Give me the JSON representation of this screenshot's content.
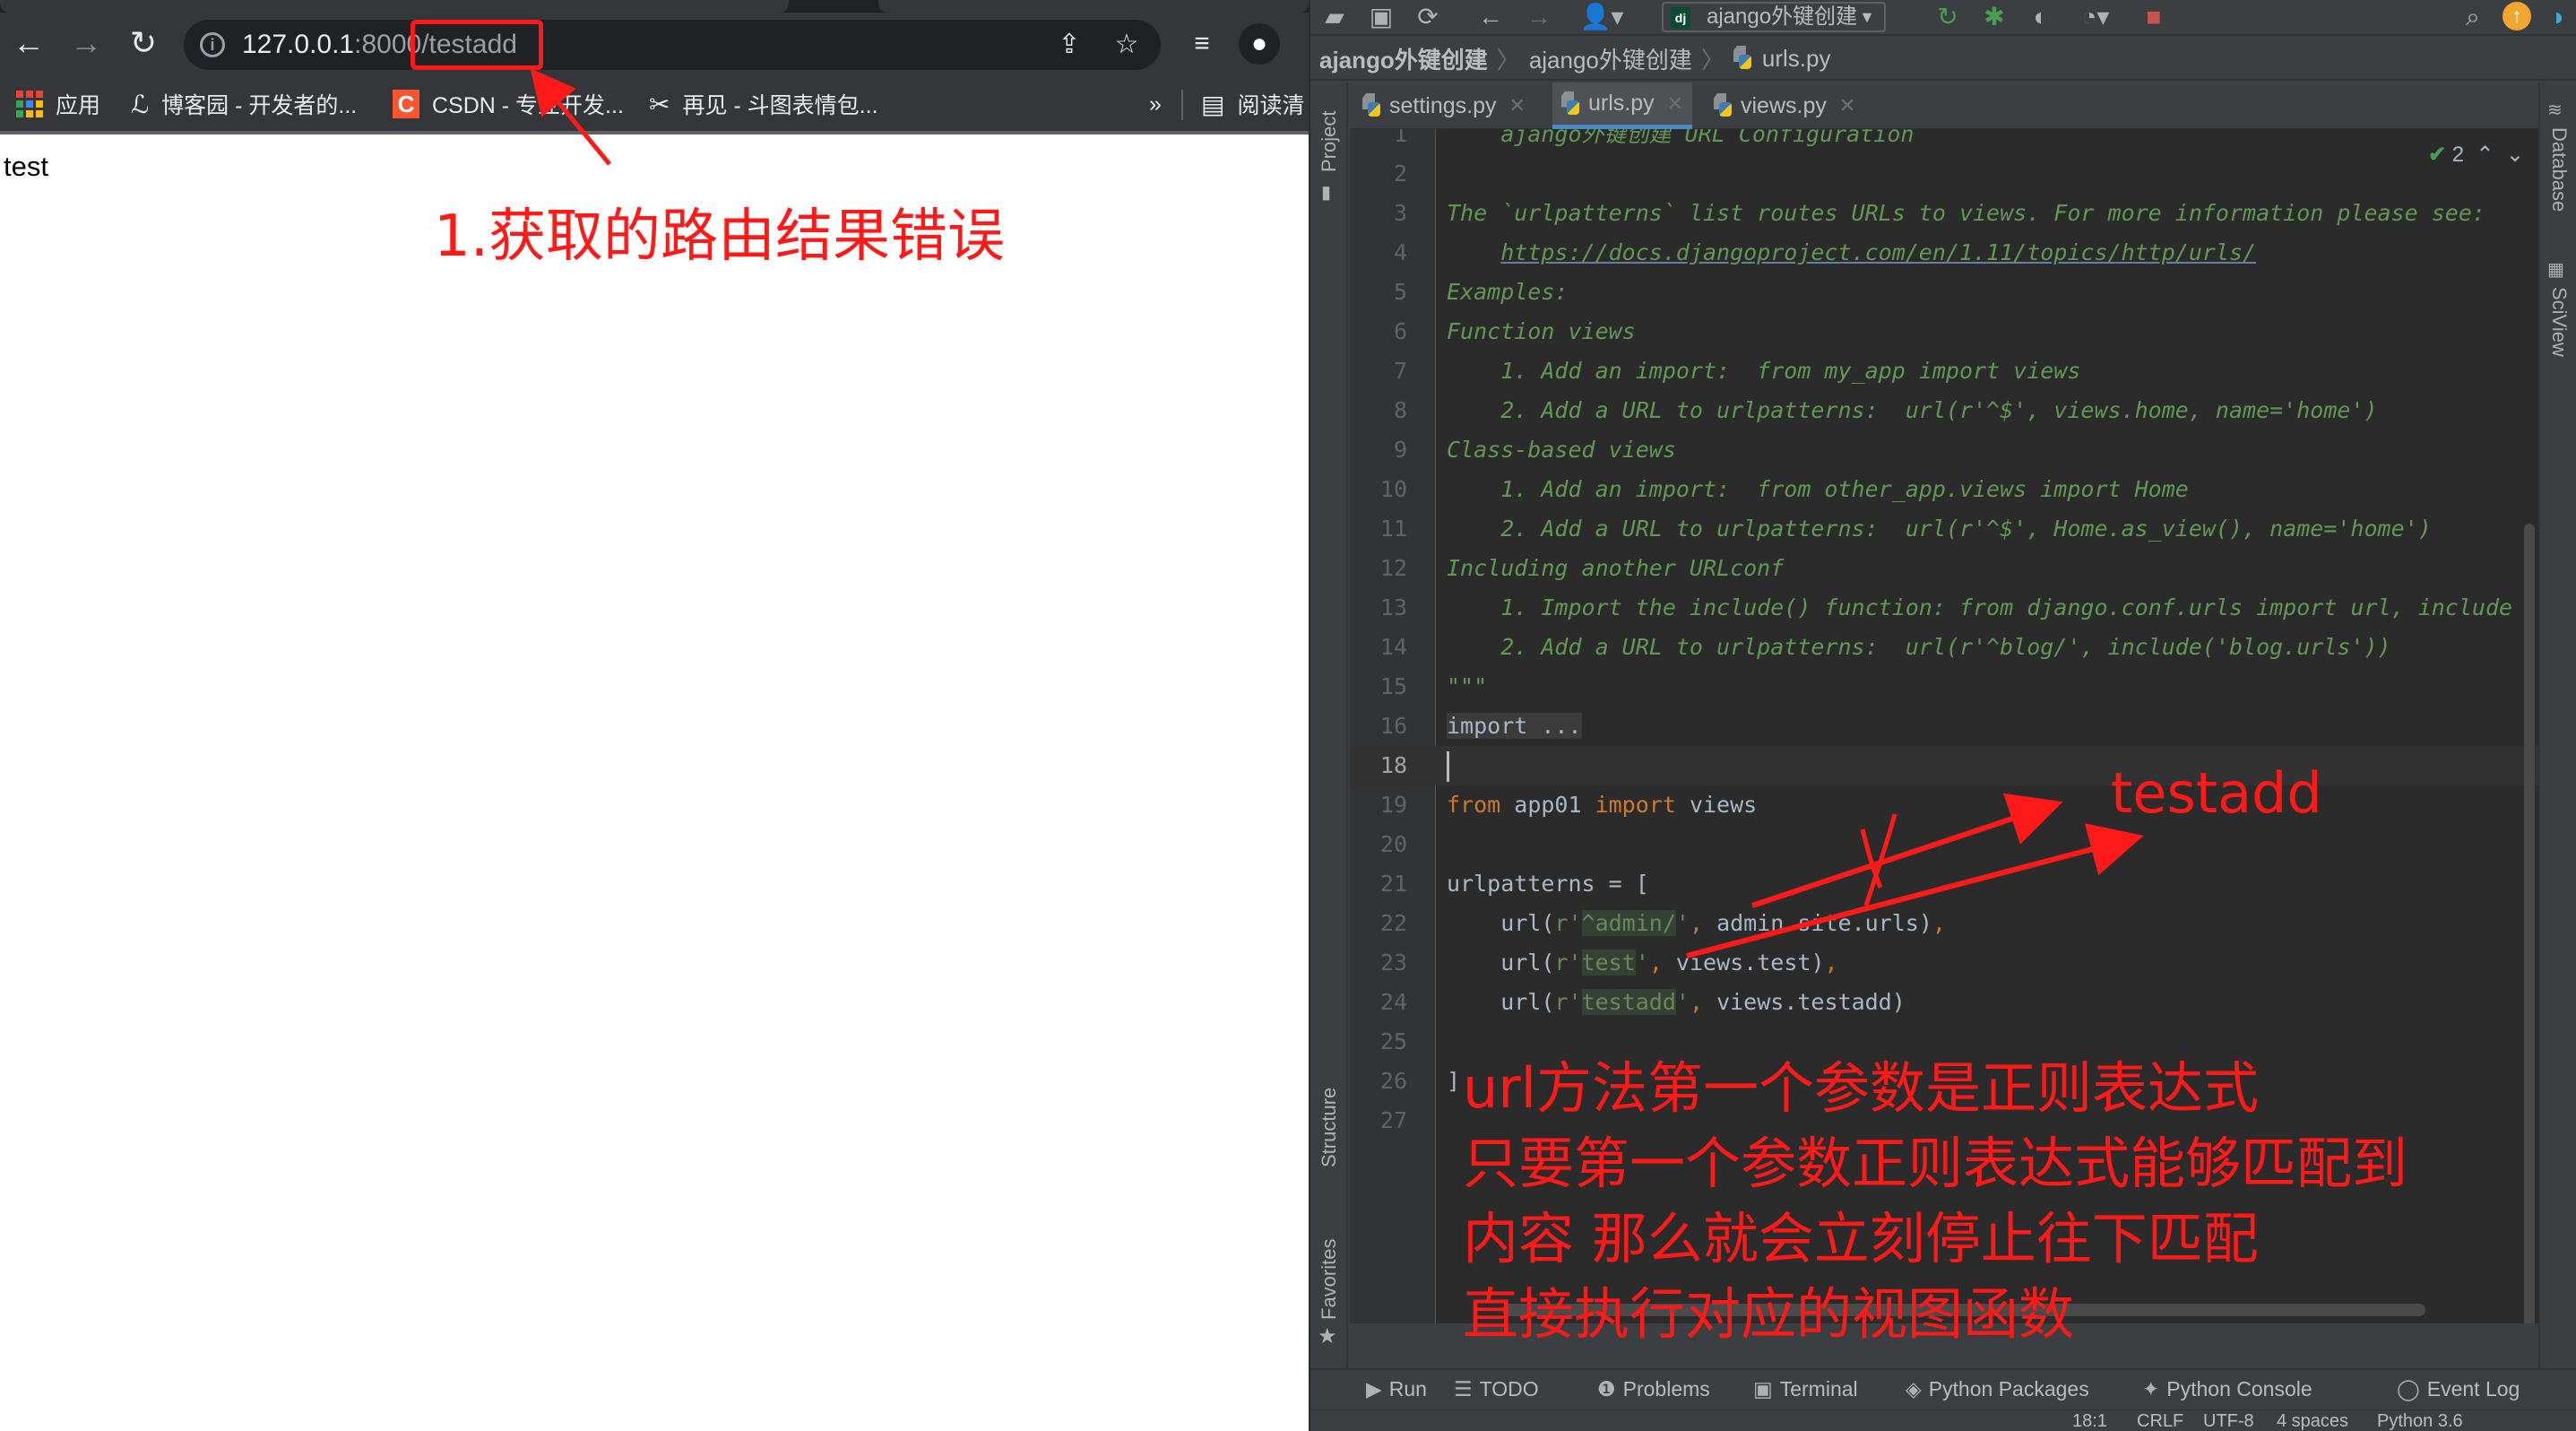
{
  "browser": {
    "url_host": "127.0.0.1",
    "url_port": ":8000",
    "url_path": "/testadd",
    "icons": {
      "back": "arrow-left-icon",
      "forward": "arrow-right-icon",
      "reload": "reload-icon",
      "info": "info-icon",
      "share": "share-icon",
      "bookmark_star": "star-icon",
      "media": "media-control-icon",
      "profile": "profile-icon"
    },
    "bookmarks": [
      {
        "label": "应用",
        "icon": "apps-grid-icon"
      },
      {
        "label": "博客园 - 开发者的...",
        "icon": "cnblogs-icon"
      },
      {
        "label": "CSDN - 专业开发...",
        "icon": "csdn-icon"
      },
      {
        "label": "再见 - 斗图表情包...",
        "icon": "doutu-icon"
      }
    ],
    "bookmarks_overflow": "»",
    "reading_list": "阅读清",
    "page_body_text": "test"
  },
  "ide": {
    "run_config": "ajango外键创建",
    "breadcrumb": [
      "ajango外键创建",
      "ajango外键创建",
      "urls.py"
    ],
    "tabs": [
      {
        "label": "settings.py",
        "active": false
      },
      {
        "label": "urls.py",
        "active": true
      },
      {
        "label": "views.py",
        "active": false
      }
    ],
    "left_tool_windows": [
      "Project",
      "Structure",
      "Favorites"
    ],
    "right_tool_windows": [
      "Database",
      "SciView"
    ],
    "inspection_count": "2",
    "current_line": 18,
    "code_lines": [
      {
        "n": "1",
        "segments": [
          {
            "t": "    ajango外键创建 URL Configuration",
            "c": "doc"
          }
        ]
      },
      {
        "n": "2",
        "segments": []
      },
      {
        "n": "3",
        "segments": [
          {
            "t": "The `urlpatterns` list routes URLs to views. For more information please see:",
            "c": "doc"
          }
        ]
      },
      {
        "n": "4",
        "segments": [
          {
            "t": "    ",
            "c": "doc"
          },
          {
            "t": "https://docs.djangoproject.com/en/1.11/topics/http/urls/",
            "c": "link"
          }
        ]
      },
      {
        "n": "5",
        "segments": [
          {
            "t": "Examples:",
            "c": "doc"
          }
        ]
      },
      {
        "n": "6",
        "segments": [
          {
            "t": "Function views",
            "c": "doc"
          }
        ]
      },
      {
        "n": "7",
        "segments": [
          {
            "t": "    1. Add an import:  from my_app import views",
            "c": "doc"
          }
        ]
      },
      {
        "n": "8",
        "segments": [
          {
            "t": "    2. Add a URL to urlpatterns:  url(r'^$', views.home, name='home')",
            "c": "doc"
          }
        ]
      },
      {
        "n": "9",
        "segments": [
          {
            "t": "Class-based views",
            "c": "doc"
          }
        ]
      },
      {
        "n": "10",
        "segments": [
          {
            "t": "    1. Add an import:  from other_app.views import Home",
            "c": "doc"
          }
        ]
      },
      {
        "n": "11",
        "segments": [
          {
            "t": "    2. Add a URL to urlpatterns:  url(r'^$', Home.as_view(), name='home')",
            "c": "doc"
          }
        ]
      },
      {
        "n": "12",
        "segments": [
          {
            "t": "Including another URLconf",
            "c": "doc"
          }
        ]
      },
      {
        "n": "13",
        "segments": [
          {
            "t": "    1. Import the include() function: from django.conf.urls import url, include",
            "c": "doc"
          }
        ]
      },
      {
        "n": "14",
        "segments": [
          {
            "t": "    2. Add a URL to urlpatterns:  url(r'^blog/', include('blog.urls'))",
            "c": "doc"
          }
        ]
      },
      {
        "n": "15",
        "segments": [
          {
            "t": "\"\"\"",
            "c": "doc"
          }
        ]
      },
      {
        "n": "16",
        "segments": [
          {
            "t": "import ...",
            "c": "importfold"
          }
        ]
      },
      {
        "n": "18",
        "segments": [
          {
            "t": "",
            "c": "caret"
          }
        ]
      },
      {
        "n": "19",
        "segments": [
          {
            "t": "from",
            "c": "kw"
          },
          {
            "t": " app01 ",
            "c": "plain"
          },
          {
            "t": "import",
            "c": "kw"
          },
          {
            "t": " views",
            "c": "plain"
          }
        ]
      },
      {
        "n": "20",
        "segments": []
      },
      {
        "n": "21",
        "segments": [
          {
            "t": "urlpatterns = [",
            "c": "plain"
          }
        ]
      },
      {
        "n": "22",
        "segments": [
          {
            "t": "    url(",
            "c": "plain"
          },
          {
            "t": "r'",
            "c": "str"
          },
          {
            "t": "^admin/",
            "c": "strhl"
          },
          {
            "t": "'",
            "c": "str"
          },
          {
            "t": ",",
            "c": "kw"
          },
          {
            "t": " admin.site.urls)",
            "c": "plain"
          },
          {
            "t": ",",
            "c": "kw"
          }
        ]
      },
      {
        "n": "23",
        "segments": [
          {
            "t": "    url(",
            "c": "plain"
          },
          {
            "t": "r'",
            "c": "str"
          },
          {
            "t": "test",
            "c": "strhl"
          },
          {
            "t": "'",
            "c": "str"
          },
          {
            "t": ",",
            "c": "kw"
          },
          {
            "t": " views.test)",
            "c": "plain"
          },
          {
            "t": ",",
            "c": "kw"
          }
        ]
      },
      {
        "n": "24",
        "segments": [
          {
            "t": "    url(",
            "c": "plain"
          },
          {
            "t": "r'",
            "c": "str"
          },
          {
            "t": "testadd",
            "c": "strhl"
          },
          {
            "t": "'",
            "c": "str"
          },
          {
            "t": ",",
            "c": "kw"
          },
          {
            "t": " views.testadd)",
            "c": "plain"
          }
        ]
      },
      {
        "n": "25",
        "segments": []
      },
      {
        "n": "26",
        "segments": [
          {
            "t": "]",
            "c": "plain"
          }
        ]
      },
      {
        "n": "27",
        "segments": []
      }
    ],
    "bottom_tools": [
      {
        "label": "Run",
        "icon": "run-icon"
      },
      {
        "label": "TODO",
        "icon": "todo-icon"
      },
      {
        "label": "Problems",
        "icon": "problems-icon"
      },
      {
        "label": "Terminal",
        "icon": "terminal-icon"
      },
      {
        "label": "Python Packages",
        "icon": "packages-icon"
      },
      {
        "label": "Python Console",
        "icon": "python-console-icon"
      },
      {
        "label": "Event Log",
        "icon": "event-log-icon"
      }
    ],
    "status": {
      "position": "18:1",
      "line_sep": "CRLF",
      "encoding": "UTF-8",
      "indent": "4 spaces",
      "interpreter": "Python 3.6"
    }
  },
  "annotations": {
    "browser_note": "1.获取的路由结果错误",
    "target_label": "testadd",
    "cross_mark": "X",
    "explanation": [
      "url方法第一个参数是正则表达式",
      "只要第一个参数正则表达式能够匹配到",
      "内容 那么就会立刻停止往下匹配",
      "直接执行对应的视图函数"
    ],
    "color": "#ff1a1a"
  }
}
